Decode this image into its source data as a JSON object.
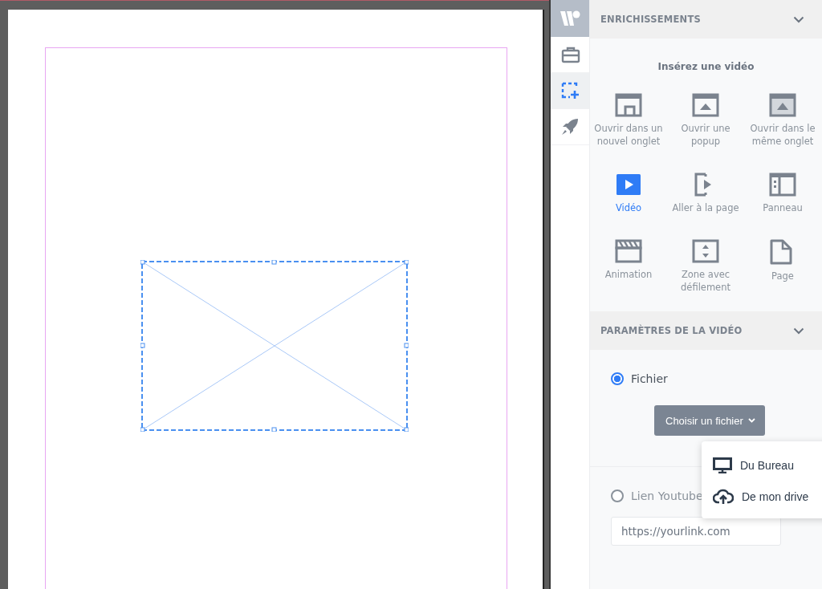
{
  "toolbar": {
    "items": [
      {
        "kind": "toolbox",
        "selected": false
      },
      {
        "kind": "frame-add",
        "selected": true
      },
      {
        "kind": "rocket",
        "selected": false
      }
    ]
  },
  "enrichments": {
    "title": "ENRICHISSEMENTS",
    "subtitle": "Insérez une vidéo",
    "items": [
      {
        "kind": "new-tab",
        "label": "Ouvrir dans un nouvel onglet",
        "selected": false
      },
      {
        "kind": "popup",
        "label": "Ouvrir une popup",
        "selected": false
      },
      {
        "kind": "same-tab",
        "label": "Ouvrir dans le même onglet",
        "selected": false
      },
      {
        "kind": "video",
        "label": "Vidéo",
        "selected": true
      },
      {
        "kind": "goto",
        "label": "Aller à la page",
        "selected": false
      },
      {
        "kind": "panel",
        "label": "Panneau",
        "selected": false
      },
      {
        "kind": "animation",
        "label": "Animation",
        "selected": false
      },
      {
        "kind": "scroll",
        "label": "Zone avec défilement",
        "selected": false
      },
      {
        "kind": "page",
        "label": "Page",
        "selected": false
      }
    ]
  },
  "video_settings": {
    "title": "PARAMÈTRES DE LA VIDÉO",
    "file_option": {
      "label": "Fichier",
      "selected": true
    },
    "choose_button": "Choisir un fichier",
    "link_option": {
      "label": "Lien Youtube",
      "selected": false
    },
    "link_field": {
      "placeholder": "https://yourlink.com"
    }
  },
  "file_menu": {
    "items": [
      {
        "kind": "desktop",
        "label": "Du Bureau"
      },
      {
        "kind": "cloud",
        "label": "De mon drive"
      }
    ]
  }
}
